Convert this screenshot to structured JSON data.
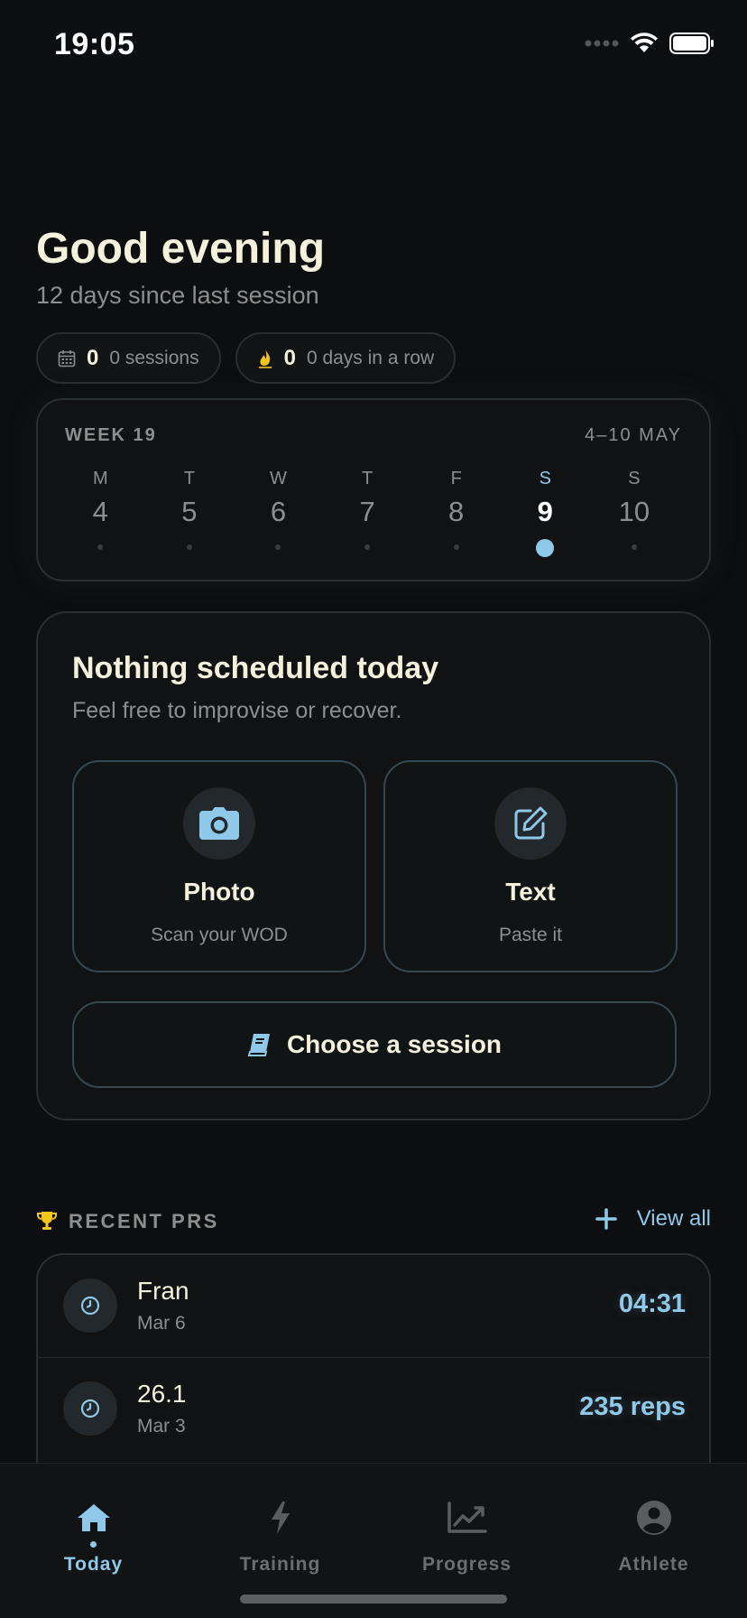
{
  "status_bar": {
    "time": "19:05"
  },
  "header": {
    "greeting": "Good evening",
    "subtitle": "12 days since last session"
  },
  "stats": {
    "sessions_count": "0",
    "sessions_label": "0 sessions",
    "streak_count": "0",
    "streak_label": "0 days in a row"
  },
  "week": {
    "title": "WEEK 19",
    "range": "4–10 MAY",
    "days": [
      {
        "letter": "M",
        "num": "4"
      },
      {
        "letter": "T",
        "num": "5"
      },
      {
        "letter": "W",
        "num": "6"
      },
      {
        "letter": "T",
        "num": "7"
      },
      {
        "letter": "F",
        "num": "8"
      },
      {
        "letter": "S",
        "num": "9"
      },
      {
        "letter": "S",
        "num": "10"
      }
    ],
    "selected_day": "9"
  },
  "today": {
    "title": "Nothing scheduled today",
    "subtitle": "Feel free to improvise or recover.",
    "photo_title": "Photo",
    "photo_sub": "Scan your WOD",
    "text_title": "Text",
    "text_sub": "Paste it",
    "choose_label": "Choose a session"
  },
  "prs": {
    "title": "RECENT PRS",
    "view_all": "View all",
    "items": [
      {
        "name": "Fran",
        "date": "Mar 6",
        "value": "04:31"
      },
      {
        "name": "26.1",
        "date": "Mar 3",
        "value": "235 reps"
      }
    ]
  },
  "tabs": [
    {
      "label": "Today",
      "icon": "home-icon"
    },
    {
      "label": "Training",
      "icon": "lightning-icon"
    },
    {
      "label": "Progress",
      "icon": "chart-icon"
    },
    {
      "label": "Athlete",
      "icon": "user-icon"
    }
  ],
  "colors": {
    "accent": "#8ec9ea",
    "background": "#0d0e0f",
    "card": "#101213",
    "text": "#f4f1dc",
    "muted": "#8d8f8f",
    "trophy": "#f5c518"
  }
}
